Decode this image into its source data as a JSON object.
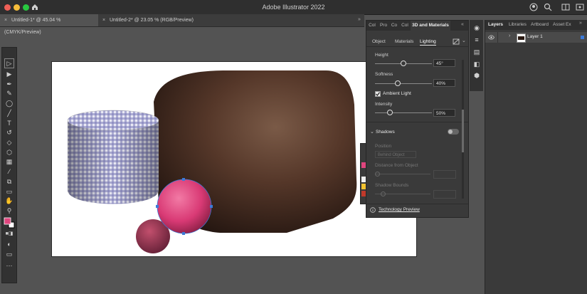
{
  "app": {
    "title": "Adobe Illustrator 2022"
  },
  "tabs": [
    {
      "label": "Untitled-1* @ 45.04 % (CMYK/Preview)",
      "active": true
    },
    {
      "label": "Untitled-2* @ 23.05 % (RGB/Preview)",
      "active": false
    }
  ],
  "panel3d": {
    "tabs": [
      "Col",
      "Pro",
      "Co",
      "Col",
      "3D and Materials"
    ],
    "subtabs": [
      "Object",
      "Materials",
      "Lighting"
    ],
    "active_subtab": "Lighting",
    "height": {
      "label": "Height",
      "value": "45°",
      "fraction": 0.45
    },
    "softness": {
      "label": "Softness",
      "value": "40%",
      "fraction": 0.4
    },
    "ambient": {
      "label": "Ambient Light",
      "checked": true
    },
    "intensity": {
      "label": "Intensity",
      "value": "50%",
      "fraction": 0.25
    },
    "shadows": {
      "label": "Shadows",
      "enabled": false,
      "position_label": "Position",
      "position_value": "Behind Object",
      "distance_label": "Distance from Object",
      "bounds_label": "Shadow Bounds"
    },
    "footer": "Technology Preview"
  },
  "layers_panel": {
    "tabs": [
      "Layers",
      "Libraries",
      "Artboard",
      "Asset Ex"
    ],
    "layer_name": "Layer 1"
  },
  "colors": {
    "fill": "#e0457e",
    "accent": "#3b7ad8"
  }
}
